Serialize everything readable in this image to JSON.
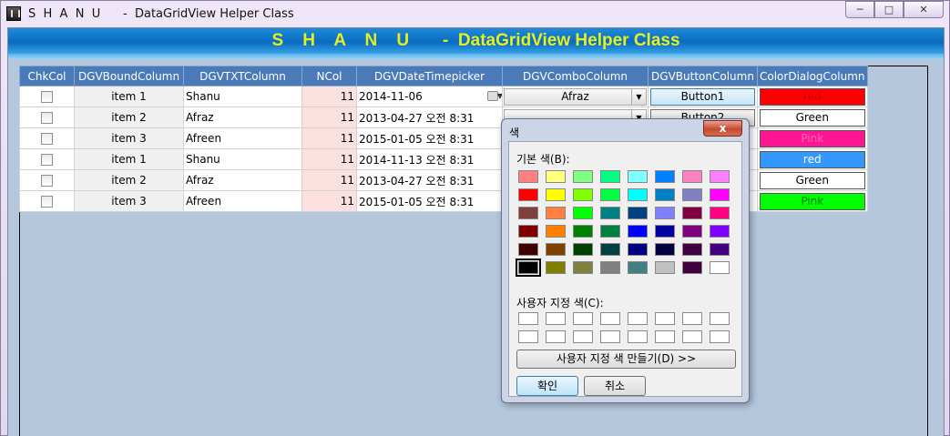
{
  "window": {
    "title": "S  H  A  N  U      -  DataGridView Helper Class",
    "controls": [
      "minimize",
      "maximize",
      "close"
    ]
  },
  "banner": {
    "text": "S    H    A    N    U       -  DataGridView Helper Class",
    "color": "#e6f020"
  },
  "grid": {
    "columns": [
      "ChkCol",
      "DGVBoundColumn",
      "DGVTXTColumn",
      "NCol",
      "DGVDateTimepicker",
      "DGVComboColumn",
      "DGVButtonColumn",
      "ColorDialogColumn"
    ],
    "rows": [
      {
        "bound": "item 1",
        "txt": "Shanu",
        "n": "11",
        "date": "2014-11-06",
        "combo": "Afraz",
        "button": "Button1",
        "color_label": "red",
        "color_bg": "#ff0000",
        "color_fg": "#c00000"
      },
      {
        "bound": "item 2",
        "txt": "Afraz",
        "n": "11",
        "date": "2013-04-27 오전 8:31",
        "combo": "",
        "button": "Button2",
        "color_label": "Green",
        "color_bg": "#ffffff",
        "color_fg": "#000000"
      },
      {
        "bound": "item 3",
        "txt": "Afreen",
        "n": "11",
        "date": "2015-01-05 오전 8:31",
        "combo": "",
        "button": "",
        "color_label": "Pink",
        "color_bg": "#ff1493",
        "color_fg": "#ff66b2"
      },
      {
        "bound": "item 1",
        "txt": "Shanu",
        "n": "11",
        "date": "2014-11-13 오전 8:31",
        "combo": "",
        "button": "",
        "color_label": "red",
        "color_bg": "#3399ff",
        "color_fg": "#ffffff"
      },
      {
        "bound": "item 2",
        "txt": "Afraz",
        "n": "11",
        "date": "2013-04-27 오전 8:31",
        "combo": "",
        "button": "",
        "color_label": "Green",
        "color_bg": "#ffffff",
        "color_fg": "#000000"
      },
      {
        "bound": "item 3",
        "txt": "Afreen",
        "n": "11",
        "date": "2015-01-05 오전 8:31",
        "combo": "",
        "button": "",
        "color_label": "Pink",
        "color_bg": "#00ff00",
        "color_fg": "#008000"
      }
    ]
  },
  "color_dialog": {
    "title": "색",
    "close_label": "x",
    "basic_colors_label": "기본 색(B):",
    "custom_colors_label": "사용자 지정 색(C):",
    "define_custom_label": "사용자 지정 색 만들기(D) >>",
    "ok_label": "확인",
    "cancel_label": "취소",
    "basic_colors": [
      "#ff8080",
      "#ffff80",
      "#80ff80",
      "#00ff80",
      "#80ffff",
      "#0080ff",
      "#ff80c0",
      "#ff80ff",
      "#ff0000",
      "#ffff00",
      "#80ff00",
      "#00ff40",
      "#00ffff",
      "#0080c0",
      "#8080c0",
      "#ff00ff",
      "#804040",
      "#ff8040",
      "#00ff00",
      "#008080",
      "#004080",
      "#8080ff",
      "#800040",
      "#ff0080",
      "#800000",
      "#ff8000",
      "#008000",
      "#008040",
      "#0000ff",
      "#0000a0",
      "#800080",
      "#8000ff",
      "#400000",
      "#804000",
      "#004000",
      "#004040",
      "#000080",
      "#000040",
      "#400040",
      "#400080",
      "#000000",
      "#808000",
      "#808040",
      "#808080",
      "#408080",
      "#c0c0c0",
      "#400040",
      "#ffffff"
    ],
    "selected_color": "#000000",
    "custom_colors": [
      "#ffffff",
      "#ffffff",
      "#ffffff",
      "#ffffff",
      "#ffffff",
      "#ffffff",
      "#ffffff",
      "#ffffff",
      "#ffffff",
      "#ffffff",
      "#ffffff",
      "#ffffff",
      "#ffffff",
      "#ffffff",
      "#ffffff",
      "#ffffff"
    ]
  }
}
